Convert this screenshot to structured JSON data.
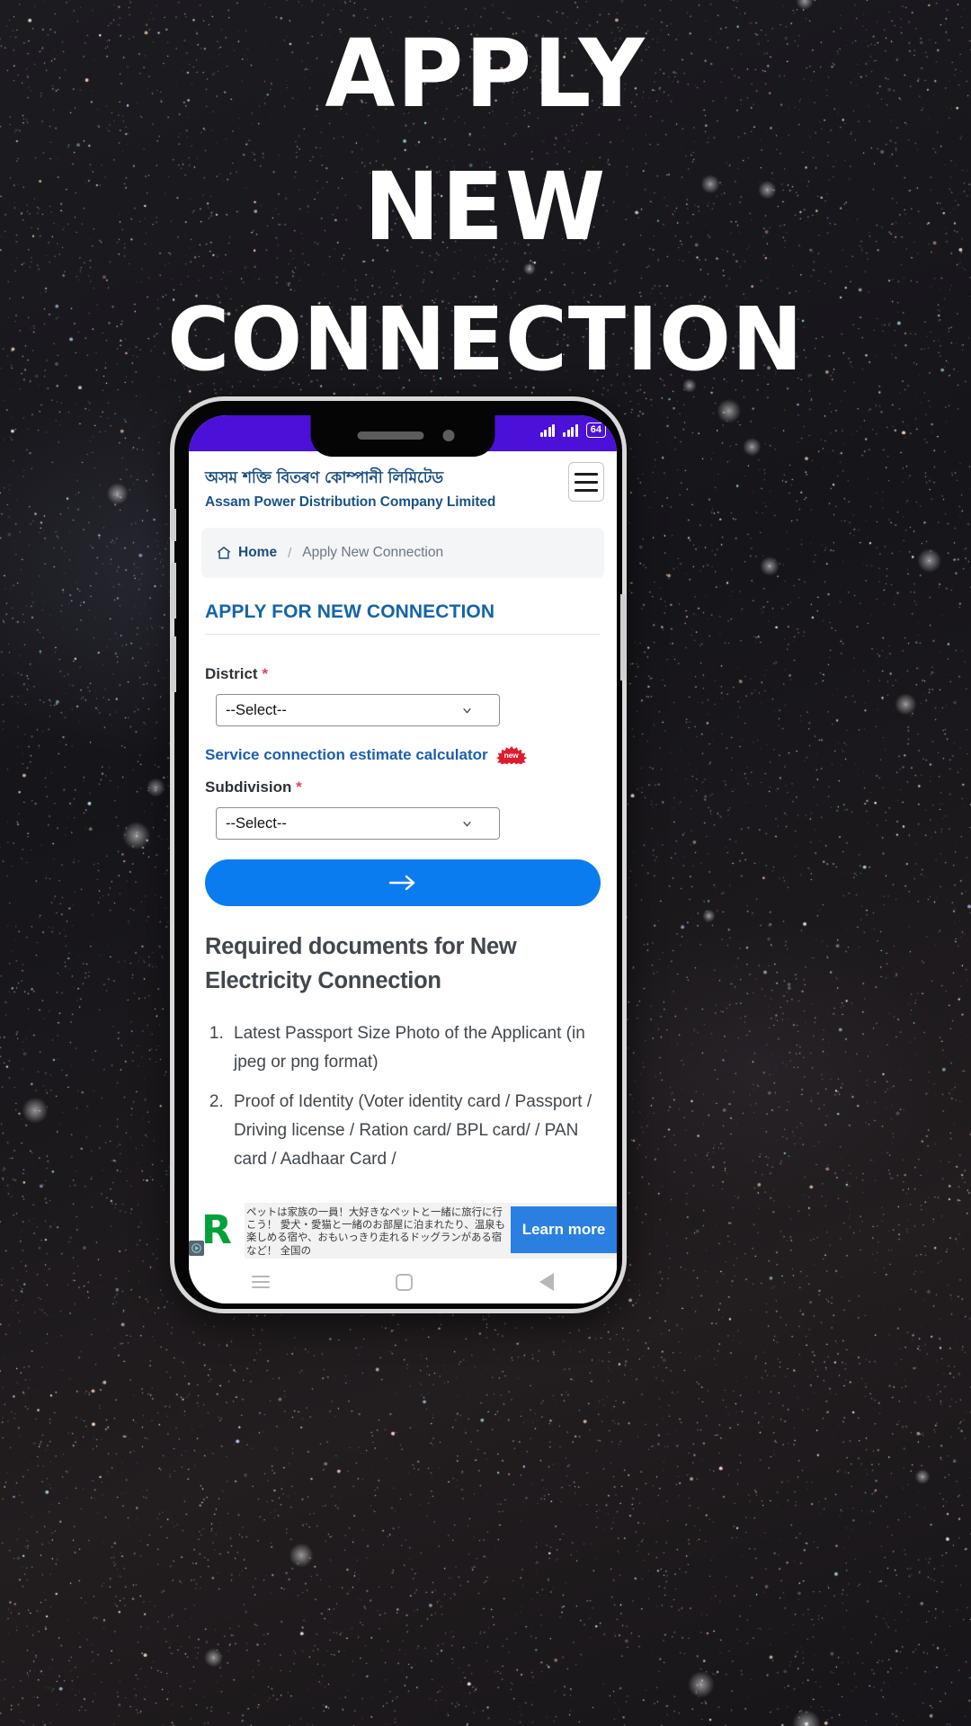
{
  "poster": {
    "headline_lines": [
      "APPLY",
      "NEW",
      "CONNECTION"
    ],
    "background_style": "starfield"
  },
  "phone": {
    "status_bar": {
      "signal_1_icon": "signal-bars-icon",
      "signal_2_icon": "signal-bars-icon",
      "battery_level": "64"
    },
    "nav_bar": {
      "recents_icon": "recents-icon",
      "home_icon": "home-square-icon",
      "back_icon": "back-triangle-icon"
    }
  },
  "site": {
    "brand_assamese": "অসম শক্তি বিতৰণ কোম্পানী লিমিটেড",
    "brand_english": "Assam Power Distribution Company Limited",
    "menu_icon": "hamburger-menu-icon"
  },
  "breadcrumb": {
    "home_icon": "house-icon",
    "home_label": "Home",
    "separator": "/",
    "current": "Apply New Connection"
  },
  "form": {
    "title": "APPLY FOR NEW CONNECTION",
    "district": {
      "label": "District",
      "required_mark": "*",
      "value": "--Select--",
      "caret_icon": "chevron-down-icon"
    },
    "calculator_link": {
      "label": "Service connection estimate calculator",
      "badge": "new"
    },
    "subdivision": {
      "label": "Subdivision",
      "required_mark": "*",
      "value": "--Select--",
      "caret_icon": "chevron-down-icon"
    },
    "submit": {
      "icon": "arrow-right-icon",
      "label": ""
    }
  },
  "documents": {
    "heading": "Required documents for New Electricity Connection",
    "items": [
      "Latest Passport Size Photo of the Applicant (in jpeg or png format)",
      "Proof of Identity (Voter identity card / Passport / Driving license / Ration card/ BPL card/ / PAN card / Aadhaar Card /"
    ]
  },
  "ad": {
    "logo_mark": "R",
    "adchoices_icon": "adchoices-icon",
    "body": "ペットは家族の一員！大好きなペットと一緒に旅行に行こう！ 愛犬・愛猫と一緒のお部屋に泊まれたり、温泉も楽しめる宿や、おもいっきり走れるドッグランがある宿など！ 全国の",
    "cta_label": "Learn more"
  },
  "colors": {
    "brand_blue": "#1b5286",
    "accent_blue": "#0b7cef",
    "status_purple": "#4b11d8",
    "required_red": "#d6455d",
    "badge_red": "#e01b2e",
    "ad_green": "#00a13a"
  }
}
